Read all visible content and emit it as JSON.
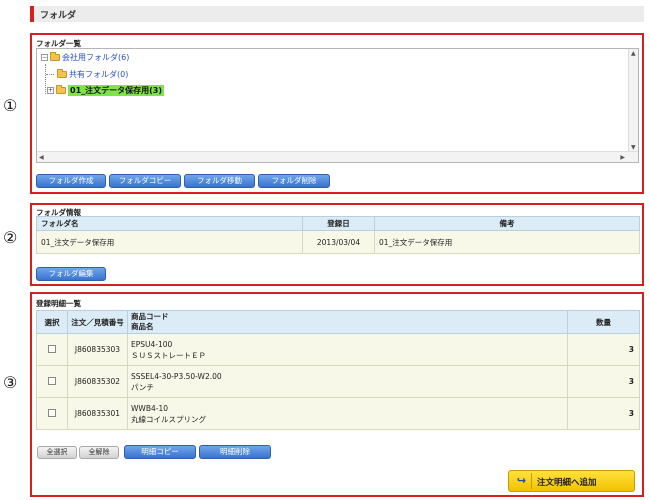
{
  "header": {
    "title": "フォルダ"
  },
  "callouts": [
    "①",
    "②",
    "③"
  ],
  "folder_list": {
    "title": "フォルダ一覧",
    "tree": [
      {
        "label": "会社用フォルダ(6)",
        "expander": "−",
        "level": 0
      },
      {
        "label": "共有フォルダ(0)",
        "level": 1
      },
      {
        "label": "01_注文データ保存用(3)",
        "expander": "+",
        "level": 1,
        "selected": true
      }
    ],
    "buttons": [
      "フォルダ作成",
      "フォルダコピー",
      "フォルダ移動",
      "フォルダ削除"
    ]
  },
  "folder_info": {
    "title": "フォルダ情報",
    "headers": [
      "フォルダ名",
      "登録日",
      "備考"
    ],
    "row": [
      "01_注文データ保存用",
      "2013/03/04",
      "01_注文データ保存用"
    ],
    "edit_button": "フォルダ編集"
  },
  "items": {
    "title": "登録明細一覧",
    "headers": {
      "select": "選択",
      "order_no": "注文／見積番号",
      "code": "商品コード",
      "name": "商品名",
      "qty": "数量"
    },
    "rows": [
      {
        "order_no": "J860835303",
        "code": "EPSU4-100",
        "name": "ＳＵＳストレートＥＰ",
        "qty": "3"
      },
      {
        "order_no": "J860835302",
        "code": "SSSEL4-30-P3.50-W2.00",
        "name": "パンチ",
        "qty": "3"
      },
      {
        "order_no": "J860835301",
        "code": "WWB4-10",
        "name": "丸線コイルスプリング",
        "qty": "3"
      }
    ],
    "select_all": "全選択",
    "deselect_all": "全解除",
    "copy_button": "明細コピー",
    "delete_button": "明細削除",
    "add_to_order": "注文明細へ追加"
  },
  "colors": {
    "accent_red": "#d42020",
    "button_blue": "#3a73cf",
    "selected_green": "#7fe34a",
    "add_yellow": "#f3c100"
  }
}
